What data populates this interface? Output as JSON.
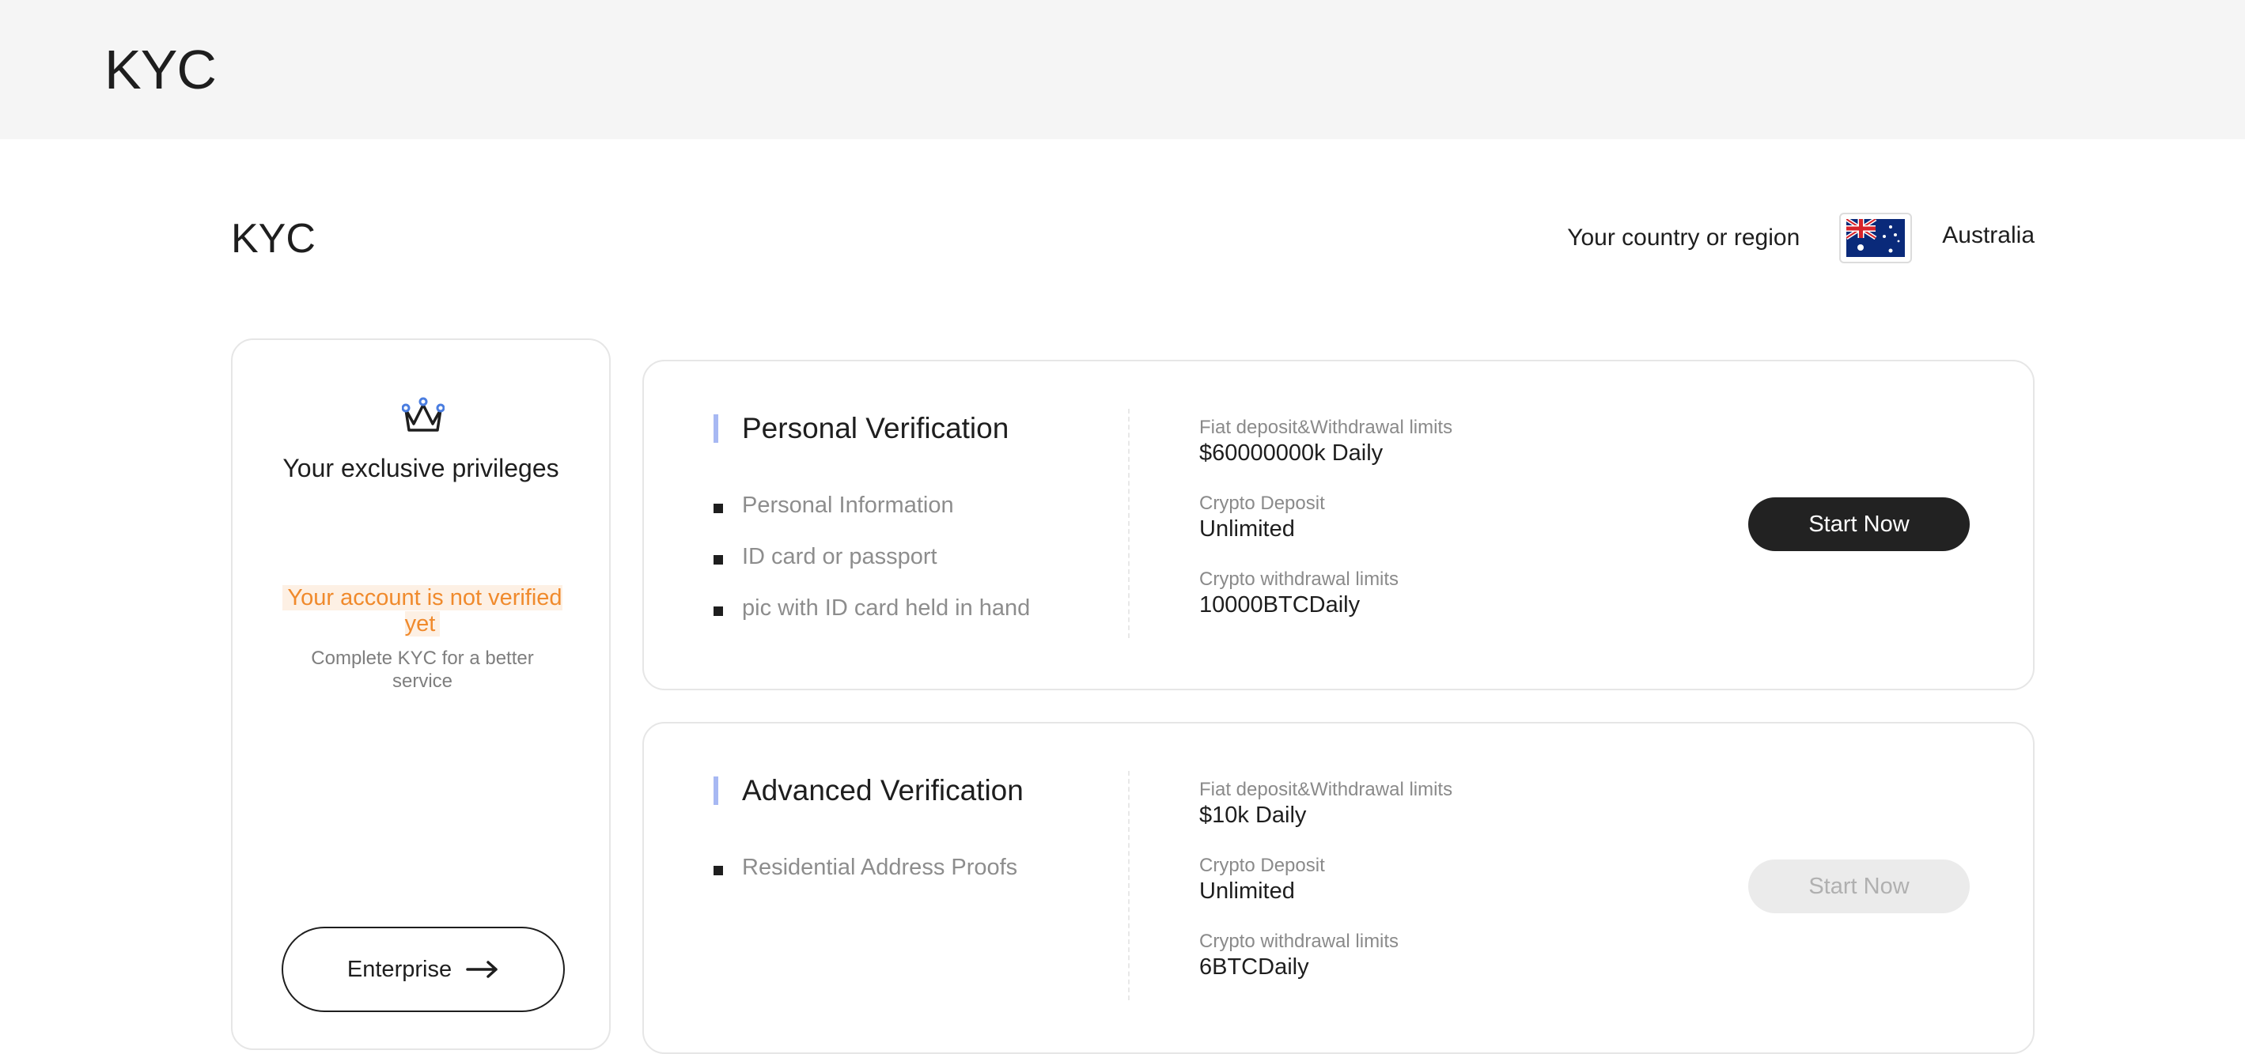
{
  "header": {
    "title": "KYC"
  },
  "page": {
    "title": "KYC"
  },
  "region": {
    "label": "Your country or region",
    "country": "Australia",
    "flag_icon": "australia-flag-icon"
  },
  "privileges": {
    "icon": "crown-icon",
    "title": "Your exclusive privileges",
    "status": "Your account is not verified yet",
    "status_color": "#f08a2c",
    "subtitle": "Complete KYC for a better service",
    "enterprise_label": "Enterprise",
    "enterprise_icon": "arrow-right-icon"
  },
  "personal": {
    "title": "Personal Verification",
    "requirements": [
      "Personal Information",
      "ID card or passport",
      "pic with ID card held in hand"
    ],
    "limits": [
      {
        "label": "Fiat deposit&Withdrawal limits",
        "value": "$60000000k Daily"
      },
      {
        "label": "Crypto Deposit",
        "value": "Unlimited"
      },
      {
        "label": "Crypto withdrawal limits",
        "value": "10000BTCDaily"
      }
    ],
    "button_label": "Start Now"
  },
  "advanced": {
    "title": "Advanced Verification",
    "requirements": [
      "Residential Address Proofs"
    ],
    "limits": [
      {
        "label": "Fiat deposit&Withdrawal limits",
        "value": "$10k Daily"
      },
      {
        "label": "Crypto Deposit",
        "value": "Unlimited"
      },
      {
        "label": "Crypto withdrawal limits",
        "value": "6BTCDaily"
      }
    ],
    "button_label": "Start Now"
  },
  "colors": {
    "accent_bar": "#a7b8f3",
    "primary_button": "#222222",
    "disabled_button": "#ebebeb"
  }
}
